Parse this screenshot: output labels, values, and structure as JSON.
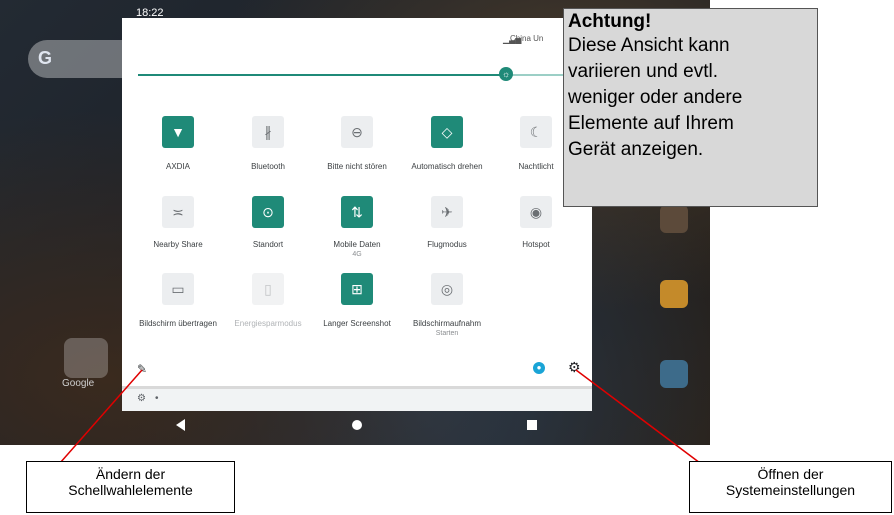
{
  "status_bar": {
    "time": "18:22",
    "carrier": "China Un"
  },
  "tiles": [
    {
      "label": "AXDIA",
      "sub": "",
      "icon": "wifi-icon",
      "glyph": "▼",
      "state": "on"
    },
    {
      "label": "Bluetooth",
      "sub": "",
      "icon": "bluetooth-icon",
      "glyph": "∦",
      "state": "off"
    },
    {
      "label": "Bitte nicht stören",
      "sub": "",
      "icon": "do-not-disturb-icon",
      "glyph": "⊖",
      "state": "off"
    },
    {
      "label": "Automatisch drehen",
      "sub": "",
      "icon": "auto-rotate-icon",
      "glyph": "◇",
      "state": "on"
    },
    {
      "label": "Nachtlicht",
      "sub": "",
      "icon": "moon-icon",
      "glyph": "☾",
      "state": "off"
    },
    {
      "label": "Nearby Share",
      "sub": "",
      "icon": "nearby-share-icon",
      "glyph": "≍",
      "state": "off"
    },
    {
      "label": "Standort",
      "sub": "",
      "icon": "location-pin-icon",
      "glyph": "⊙",
      "state": "on"
    },
    {
      "label": "Mobile Daten",
      "sub": "4G",
      "icon": "mobile-data-icon",
      "glyph": "⇅",
      "state": "on"
    },
    {
      "label": "Flugmodus",
      "sub": "",
      "icon": "airplane-icon",
      "glyph": "✈",
      "state": "off"
    },
    {
      "label": "Hotspot",
      "sub": "",
      "icon": "hotspot-icon",
      "glyph": "◉",
      "state": "off"
    },
    {
      "label": "Bildschirm übertragen",
      "sub": "",
      "icon": "cast-icon",
      "glyph": "▭",
      "state": "off"
    },
    {
      "label": "Energiesparmodus",
      "sub": "",
      "icon": "battery-icon",
      "glyph": "▯",
      "state": "dim"
    },
    {
      "label": "Langer Screenshot",
      "sub": "",
      "icon": "long-screenshot-icon",
      "glyph": "⊞",
      "state": "on"
    },
    {
      "label": "Bildschirmaufnahm",
      "sub": "Starten",
      "icon": "screen-record-icon",
      "glyph": "◎",
      "state": "off"
    }
  ],
  "brightness": {
    "level": 0.86
  },
  "warning": {
    "title": "Achtung!",
    "lines": [
      "Diese Ansicht kann",
      "variieren und evtl.",
      "weniger oder andere",
      "Elemente auf Ihrem",
      "Gerät anzeigen."
    ]
  },
  "callouts": {
    "left_line1": "Ändern der",
    "left_line2": "Schellwahlelemente",
    "right_line1": "Öffnen der",
    "right_line2": "Systemeinstellungen"
  },
  "home": {
    "folder_label": "Google"
  },
  "colors": {
    "accent": "#1f8a78",
    "annotation_line": "#e00000"
  }
}
